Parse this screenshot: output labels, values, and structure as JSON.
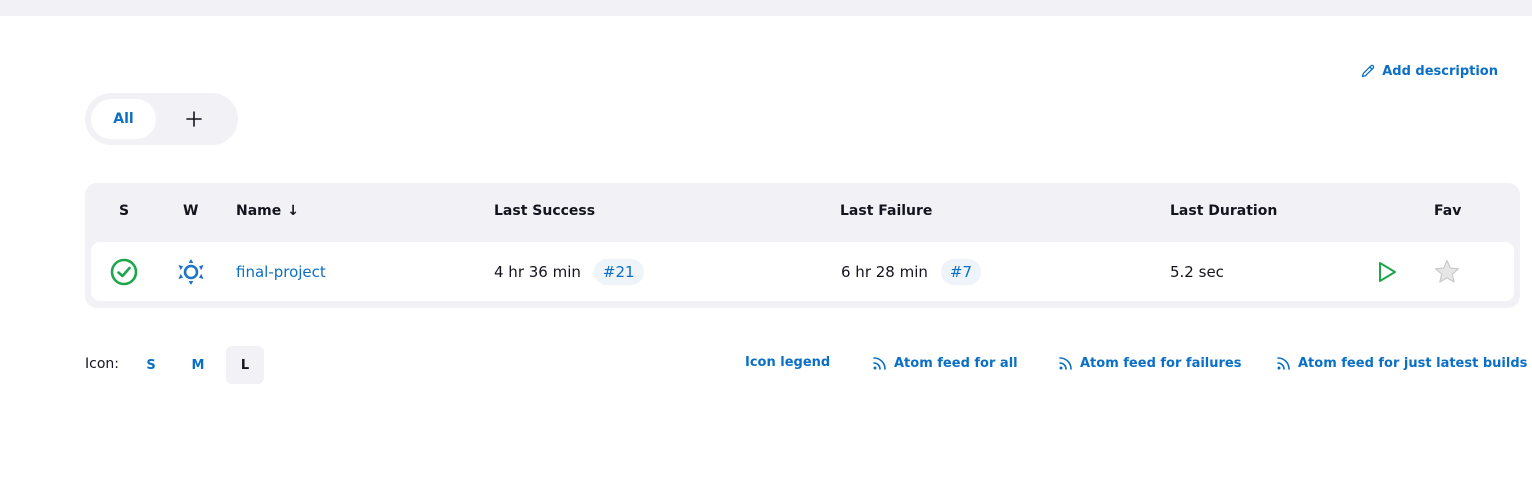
{
  "header": {
    "add_description": "Add description"
  },
  "tabs": {
    "all": "All",
    "add": "+"
  },
  "table": {
    "columns": {
      "s": "S",
      "w": "W",
      "name": "Name",
      "last_success": "Last Success",
      "last_failure": "Last Failure",
      "last_duration": "Last Duration",
      "fav": "Fav"
    },
    "sort_indicator": "↓",
    "rows": [
      {
        "status_icon": "success-check-icon",
        "weather_icon": "sunny-weather-icon",
        "name": "final-project",
        "last_success": "4 hr 36 min",
        "last_success_build": "#21",
        "last_failure": "6 hr 28 min",
        "last_failure_build": "#7",
        "last_duration": "5.2 sec"
      }
    ]
  },
  "footer": {
    "icon_label": "Icon:",
    "sizes": [
      "S",
      "M",
      "L"
    ],
    "selected_size": "L",
    "icon_legend": "Icon legend",
    "atom_all": "Atom feed for all",
    "atom_failures": "Atom feed for failures",
    "atom_latest": "Atom feed for just latest builds"
  },
  "colors": {
    "link": "#0b6fc6",
    "success": "#1ea64b",
    "weather": "#1e73c8",
    "panel_bg": "#f2f2f6"
  }
}
